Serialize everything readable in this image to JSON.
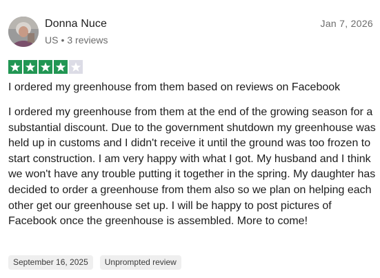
{
  "reviewer": {
    "name": "Donna Nuce",
    "country": "US",
    "separator": "•",
    "review_count": "3 reviews"
  },
  "review": {
    "date": "Jan 7, 2026",
    "rating": 4,
    "max_rating": 5,
    "star_color": "#219653",
    "empty_star_color": "#dcdce6",
    "title": "I ordered my greenhouse from them based on reviews on Facebook",
    "body": "I ordered my greenhouse from them at the end of the growing season for a substantial discount. Due to the government shutdown my greenhouse was held up in customs and I didn't receive it until the ground was too frozen to start construction. I am very happy with what I got. My husband and I think we won't have any trouble putting it together in the spring. My daughter has decided to order a greenhouse from them also so we plan on helping each other get our greenhouse set up. I will be happy to post pictures of Facebook once the greenhouse is assembled. More to come!",
    "tags": [
      "September 16, 2025",
      "Unprompted review"
    ]
  }
}
